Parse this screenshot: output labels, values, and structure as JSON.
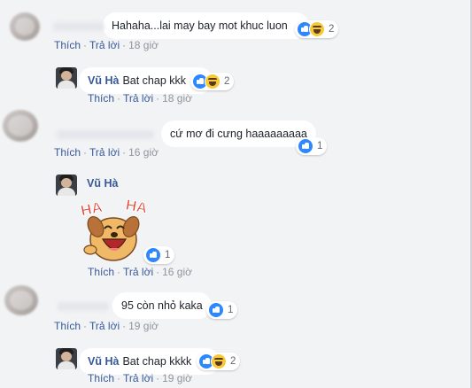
{
  "actions": {
    "like": "Thích",
    "reply": "Trả lời"
  },
  "comments": [
    {
      "author": "",
      "text": "Hahaha...lai may bay mot khuc luon",
      "reactions": {
        "types": [
          "like",
          "haha"
        ],
        "count": "2"
      },
      "time": "18 giờ"
    },
    {
      "author": "Vũ Hà",
      "text": "Bat chap kkk",
      "reactions": {
        "types": [
          "like",
          "haha"
        ],
        "count": "2"
      },
      "time": "18 giờ"
    },
    {
      "author": "",
      "text": "cứ mơ đi cưng haaaaaaaaa",
      "reactions": {
        "types": [
          "like"
        ],
        "count": "1"
      },
      "time": "16 giờ"
    },
    {
      "author": "Vũ Hà",
      "text": "",
      "sticker": {
        "left": "HA",
        "right": "HA"
      },
      "reactions": {
        "types": [
          "like"
        ],
        "count": "1"
      },
      "time": "16 giờ"
    },
    {
      "author": "",
      "text": "95 còn nhỏ kaka",
      "reactions": {
        "types": [
          "like"
        ],
        "count": "1"
      },
      "time": "19 giờ"
    },
    {
      "author": "Vũ Hà",
      "text": "Bat chap kkkk",
      "reactions": {
        "types": [
          "like",
          "haha"
        ],
        "count": "2"
      },
      "time": "19 giờ"
    }
  ],
  "colors": {
    "link": "#365899",
    "like": "#2d88ff",
    "haha": "#f7c838",
    "background": "#f2f3f5"
  }
}
